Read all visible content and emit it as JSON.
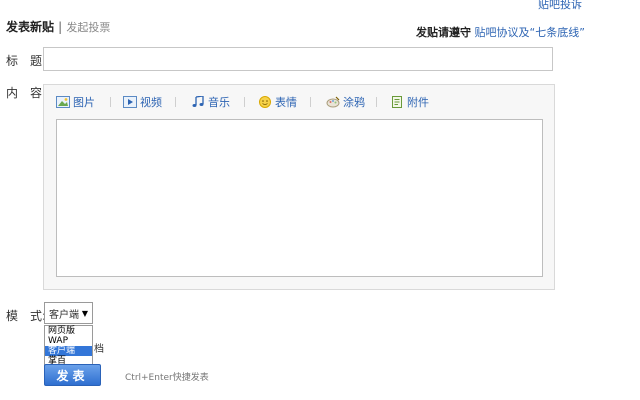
{
  "header": {
    "report_link": "贴吧投诉",
    "tabs": {
      "new_post": "发表新贴",
      "separator": "|",
      "vote": "发起投票"
    },
    "rules": {
      "prefix": "发贴请遵守",
      "link": "贴吧协议及“七条底线”"
    }
  },
  "form": {
    "title_label": "标　题:",
    "title_value": "",
    "content_label": "内　容:",
    "mode_label": "模　式:"
  },
  "editor": {
    "toolbar": [
      {
        "name": "image",
        "label": "图片",
        "icon": "image-icon"
      },
      {
        "name": "video",
        "label": "视频",
        "icon": "video-icon"
      },
      {
        "name": "music",
        "label": "音乐",
        "icon": "music-icon"
      },
      {
        "name": "emoji",
        "label": "表情",
        "icon": "smiley-icon"
      },
      {
        "name": "graffiti",
        "label": "涂鸦",
        "icon": "graffiti-icon"
      },
      {
        "name": "attachment",
        "label": "附件",
        "icon": "attachment-icon"
      }
    ],
    "body_value": ""
  },
  "mode": {
    "selected": "客户端",
    "options": [
      "网页版",
      "WAP",
      "客户端",
      "掌百"
    ],
    "highlighted_index": 2
  },
  "partial_text": "档",
  "submit": {
    "label": "发表",
    "hint": "Ctrl+Enter快捷发表"
  },
  "colors": {
    "link": "#2d64b3",
    "button_top": "#6aa1ea",
    "button_bottom": "#2f6fd0",
    "highlight": "#3376d8"
  }
}
